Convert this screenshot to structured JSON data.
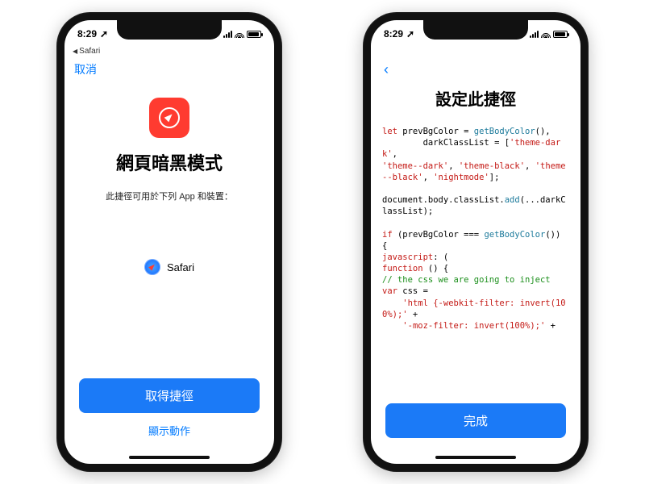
{
  "statusbar": {
    "time": "8:29",
    "loc_arrow": "➚",
    "back_app_chevron": "◀",
    "back_app": "Safari"
  },
  "left": {
    "cancel": "取消",
    "shortcut_name": "網頁暗黑模式",
    "subtitle": "此捷徑可用於下列 App 和裝置：",
    "safari_label": "Safari",
    "get_btn": "取得捷徑",
    "show_actions": "顯示動作"
  },
  "right": {
    "title": "設定此捷徑",
    "done_btn": "完成",
    "code": {
      "l1a": "let",
      "l1b": " prevBgColor = ",
      "l1c": "getBodyColor",
      "l1d": "(),",
      "l2a": "        darkClassList = [",
      "l2b": "'theme-dark'",
      "l2c": ", ",
      "l3a": "'theme--dark'",
      "l3b": ", ",
      "l3c": "'theme-black'",
      "l3d": ", ",
      "l3e": "'theme--black'",
      "l3f": ", ",
      "l3g": "'nightmode'",
      "l3h": "];",
      "l4a": "document.body.classList.",
      "l4b": "add",
      "l4c": "(...darkClassList);",
      "l5a": "if",
      "l5b": " (prevBgColor === ",
      "l5c": "getBodyColor",
      "l5d": "()) {",
      "l6a": "javascript",
      "l6b": ": (",
      "l7a": "function",
      "l7b": " () {",
      "l8": "// the css we are going to inject",
      "l9a": "var",
      "l9b": " css =",
      "l10a": "    'html {-webkit-filter: invert(100%);'",
      "l10b": " +",
      "l11a": "    '-moz-filter: invert(100%);'",
      "l11b": " +"
    }
  }
}
